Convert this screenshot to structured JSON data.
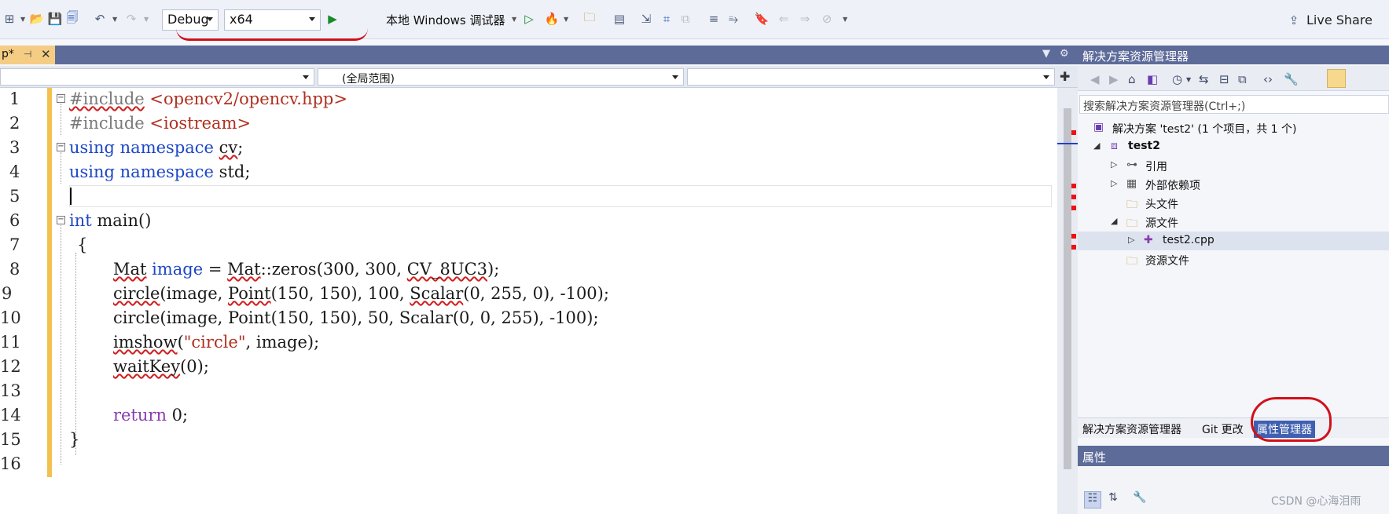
{
  "toolbar": {
    "icons": [
      "new-project-icon",
      "open-icon",
      "save-icon",
      "save-all-icon",
      "undo-icon",
      "redo-icon",
      "run-icon",
      "attach-icon",
      "file-icon",
      "format-icon",
      "bookmark-icon"
    ],
    "configuration": "Debug",
    "platform": "x64",
    "run_target": "本地 Windows 调试器",
    "live_share": "Live Share"
  },
  "editor": {
    "tab_label": "p*",
    "nav_scope": "(全局范围)",
    "line_numbers": [
      "1",
      "2",
      "3",
      "4",
      "5",
      "6",
      "7",
      "8",
      "9",
      "10",
      "11",
      "12",
      "13",
      "14",
      "15",
      "16"
    ],
    "lines": {
      "l1_a": "#include",
      "l1_b": "<opencv2/opencv.hpp>",
      "l2_a": "#include",
      "l2_b": "<iostream>",
      "l3_a": "using namespace",
      "l3_b": "cv",
      "l3_c": ";",
      "l4_a": "using namespace",
      "l4_b": "std;",
      "l6_a": "int",
      "l6_b": "main()",
      "l7": "{",
      "l8_a": "Mat",
      "l8_b": "image",
      "l8_c": " = ",
      "l8_d": "Mat",
      "l8_e": "::zeros(300, 300, ",
      "l8_f": "CV_8UC3",
      "l8_g": ");",
      "l9_a": "circle",
      "l9_b": "(image, ",
      "l9_c": "Point",
      "l9_d": "(150, 150), 100, ",
      "l9_e": "Scalar",
      "l9_f": "(0, 255, 0), -100);",
      "l10": "circle(image, Point(150, 150), 50, Scalar(0, 0, 255), -100);",
      "l11_a": "imshow",
      "l11_b": "(",
      "l11_c": "\"circle\"",
      "l11_d": ", image);",
      "l12_a": "waitKey",
      "l12_b": "(0);",
      "l14_a": "return",
      "l14_b": " 0;",
      "l15": "}"
    }
  },
  "solution_explorer": {
    "title": "解决方案资源管理器",
    "search_placeholder": "搜索解决方案资源管理器(Ctrl+;)",
    "solution": "解决方案 'test2' (1 个项目，共 1 个)",
    "project": "test2",
    "items": [
      "引用",
      "外部依赖项",
      "头文件",
      "源文件",
      "test2.cpp",
      "资源文件"
    ],
    "tabs": [
      "解决方案资源管理器",
      "Git 更改",
      "属性管理器"
    ]
  },
  "properties": {
    "title": "属性"
  },
  "watermark": "CSDN @心海泪雨",
  "colors": {
    "accent_blue": "#5d6b99",
    "highlight_red": "#d0101a",
    "keyword": "#1d47c8",
    "string": "#b03020"
  }
}
